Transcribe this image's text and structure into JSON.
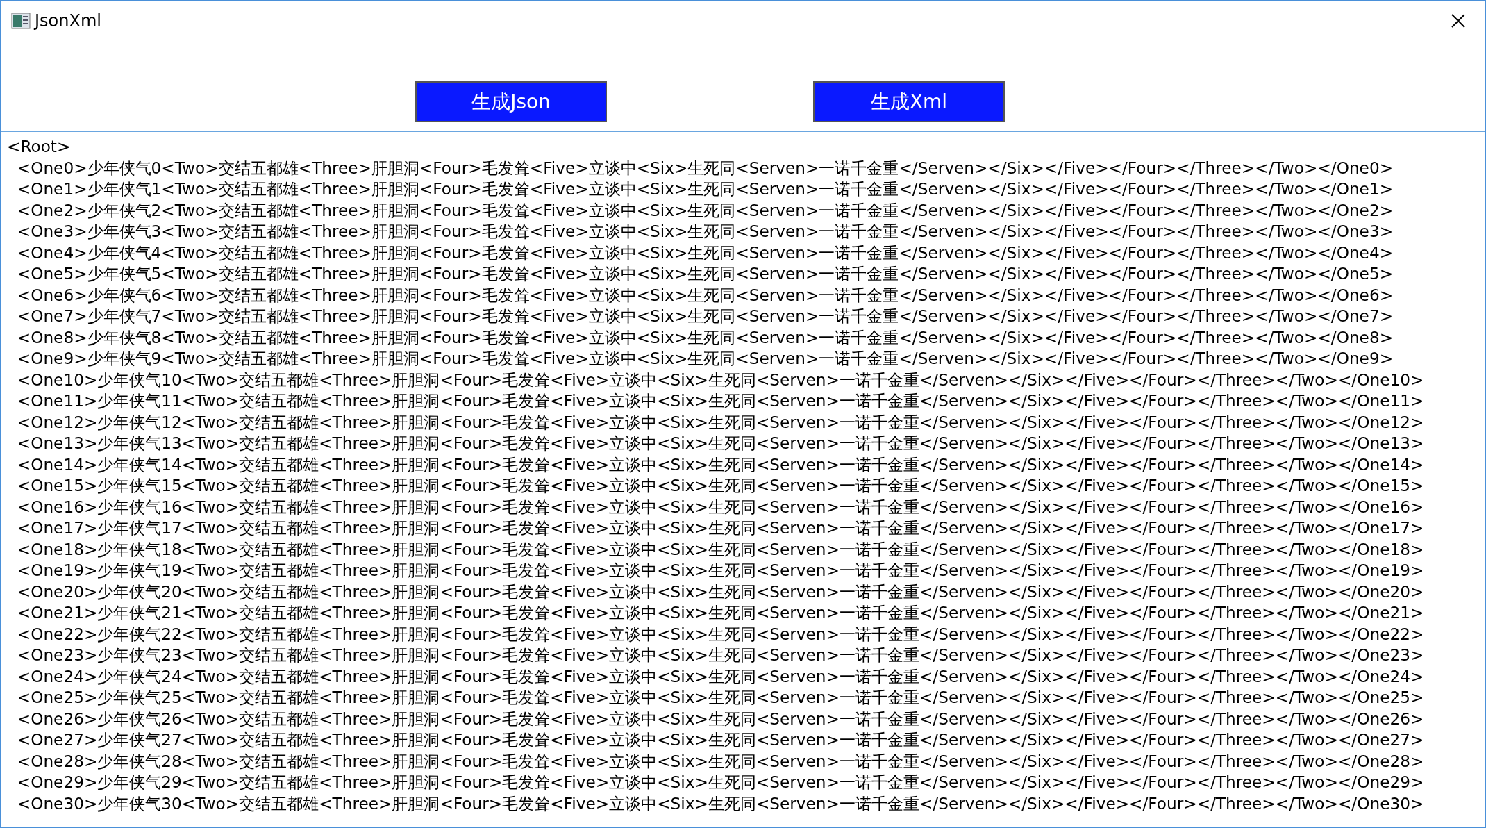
{
  "window": {
    "title": "JsonXml"
  },
  "buttons": [
    {
      "label": "生成Json"
    },
    {
      "label": "生成Xml"
    }
  ],
  "output": {
    "lines": [
      "<Root>",
      "  <One0>少年侠气0<Two>交结五都雄<Three>肝胆洞<Four>毛发耸<Five>立谈中<Six>生死同<Serven>一诺千金重</Serven></Six></Five></Four></Three></Two></One0>",
      "  <One1>少年侠气1<Two>交结五都雄<Three>肝胆洞<Four>毛发耸<Five>立谈中<Six>生死同<Serven>一诺千金重</Serven></Six></Five></Four></Three></Two></One1>",
      "  <One2>少年侠气2<Two>交结五都雄<Three>肝胆洞<Four>毛发耸<Five>立谈中<Six>生死同<Serven>一诺千金重</Serven></Six></Five></Four></Three></Two></One2>",
      "  <One3>少年侠气3<Two>交结五都雄<Three>肝胆洞<Four>毛发耸<Five>立谈中<Six>生死同<Serven>一诺千金重</Serven></Six></Five></Four></Three></Two></One3>",
      "  <One4>少年侠气4<Two>交结五都雄<Three>肝胆洞<Four>毛发耸<Five>立谈中<Six>生死同<Serven>一诺千金重</Serven></Six></Five></Four></Three></Two></One4>",
      "  <One5>少年侠气5<Two>交结五都雄<Three>肝胆洞<Four>毛发耸<Five>立谈中<Six>生死同<Serven>一诺千金重</Serven></Six></Five></Four></Three></Two></One5>",
      "  <One6>少年侠气6<Two>交结五都雄<Three>肝胆洞<Four>毛发耸<Five>立谈中<Six>生死同<Serven>一诺千金重</Serven></Six></Five></Four></Three></Two></One6>",
      "  <One7>少年侠气7<Two>交结五都雄<Three>肝胆洞<Four>毛发耸<Five>立谈中<Six>生死同<Serven>一诺千金重</Serven></Six></Five></Four></Three></Two></One7>",
      "  <One8>少年侠气8<Two>交结五都雄<Three>肝胆洞<Four>毛发耸<Five>立谈中<Six>生死同<Serven>一诺千金重</Serven></Six></Five></Four></Three></Two></One8>",
      "  <One9>少年侠气9<Two>交结五都雄<Three>肝胆洞<Four>毛发耸<Five>立谈中<Six>生死同<Serven>一诺千金重</Serven></Six></Five></Four></Three></Two></One9>",
      "  <One10>少年侠气10<Two>交结五都雄<Three>肝胆洞<Four>毛发耸<Five>立谈中<Six>生死同<Serven>一诺千金重</Serven></Six></Five></Four></Three></Two></One10>",
      "  <One11>少年侠气11<Two>交结五都雄<Three>肝胆洞<Four>毛发耸<Five>立谈中<Six>生死同<Serven>一诺千金重</Serven></Six></Five></Four></Three></Two></One11>",
      "  <One12>少年侠气12<Two>交结五都雄<Three>肝胆洞<Four>毛发耸<Five>立谈中<Six>生死同<Serven>一诺千金重</Serven></Six></Five></Four></Three></Two></One12>",
      "  <One13>少年侠气13<Two>交结五都雄<Three>肝胆洞<Four>毛发耸<Five>立谈中<Six>生死同<Serven>一诺千金重</Serven></Six></Five></Four></Three></Two></One13>",
      "  <One14>少年侠气14<Two>交结五都雄<Three>肝胆洞<Four>毛发耸<Five>立谈中<Six>生死同<Serven>一诺千金重</Serven></Six></Five></Four></Three></Two></One14>",
      "  <One15>少年侠气15<Two>交结五都雄<Three>肝胆洞<Four>毛发耸<Five>立谈中<Six>生死同<Serven>一诺千金重</Serven></Six></Five></Four></Three></Two></One15>",
      "  <One16>少年侠气16<Two>交结五都雄<Three>肝胆洞<Four>毛发耸<Five>立谈中<Six>生死同<Serven>一诺千金重</Serven></Six></Five></Four></Three></Two></One16>",
      "  <One17>少年侠气17<Two>交结五都雄<Three>肝胆洞<Four>毛发耸<Five>立谈中<Six>生死同<Serven>一诺千金重</Serven></Six></Five></Four></Three></Two></One17>",
      "  <One18>少年侠气18<Two>交结五都雄<Three>肝胆洞<Four>毛发耸<Five>立谈中<Six>生死同<Serven>一诺千金重</Serven></Six></Five></Four></Three></Two></One18>",
      "  <One19>少年侠气19<Two>交结五都雄<Three>肝胆洞<Four>毛发耸<Five>立谈中<Six>生死同<Serven>一诺千金重</Serven></Six></Five></Four></Three></Two></One19>",
      "  <One20>少年侠气20<Two>交结五都雄<Three>肝胆洞<Four>毛发耸<Five>立谈中<Six>生死同<Serven>一诺千金重</Serven></Six></Five></Four></Three></Two></One20>",
      "  <One21>少年侠气21<Two>交结五都雄<Three>肝胆洞<Four>毛发耸<Five>立谈中<Six>生死同<Serven>一诺千金重</Serven></Six></Five></Four></Three></Two></One21>",
      "  <One22>少年侠气22<Two>交结五都雄<Three>肝胆洞<Four>毛发耸<Five>立谈中<Six>生死同<Serven>一诺千金重</Serven></Six></Five></Four></Three></Two></One22>",
      "  <One23>少年侠气23<Two>交结五都雄<Three>肝胆洞<Four>毛发耸<Five>立谈中<Six>生死同<Serven>一诺千金重</Serven></Six></Five></Four></Three></Two></One23>",
      "  <One24>少年侠气24<Two>交结五都雄<Three>肝胆洞<Four>毛发耸<Five>立谈中<Six>生死同<Serven>一诺千金重</Serven></Six></Five></Four></Three></Two></One24>",
      "  <One25>少年侠气25<Two>交结五都雄<Three>肝胆洞<Four>毛发耸<Five>立谈中<Six>生死同<Serven>一诺千金重</Serven></Six></Five></Four></Three></Two></One25>",
      "  <One26>少年侠气26<Two>交结五都雄<Three>肝胆洞<Four>毛发耸<Five>立谈中<Six>生死同<Serven>一诺千金重</Serven></Six></Five></Four></Three></Two></One26>",
      "  <One27>少年侠气27<Two>交结五都雄<Three>肝胆洞<Four>毛发耸<Five>立谈中<Six>生死同<Serven>一诺千金重</Serven></Six></Five></Four></Three></Two></One27>",
      "  <One28>少年侠气28<Two>交结五都雄<Three>肝胆洞<Four>毛发耸<Five>立谈中<Six>生死同<Serven>一诺千金重</Serven></Six></Five></Four></Three></Two></One28>",
      "  <One29>少年侠气29<Two>交结五都雄<Three>肝胆洞<Four>毛发耸<Five>立谈中<Six>生死同<Serven>一诺千金重</Serven></Six></Five></Four></Three></Two></One29>",
      "  <One30>少年侠气30<Two>交结五都雄<Three>肝胆洞<Four>毛发耸<Five>立谈中<Six>生死同<Serven>一诺千金重</Serven></Six></Five></Four></Three></Two></One30>"
    ]
  }
}
